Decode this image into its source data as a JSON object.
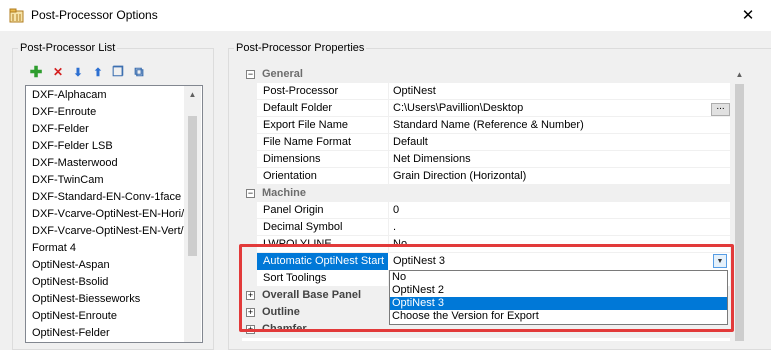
{
  "window": {
    "title": "Post-Processor Options",
    "close_glyph": "✕",
    "icon": "app-window-icon"
  },
  "left_panel": {
    "group_label": "Post-Processor List",
    "toolbar": [
      {
        "name": "add-icon",
        "glyph": "✚",
        "color": "#2e9d2e"
      },
      {
        "name": "delete-icon",
        "glyph": "✕",
        "color": "#d42020"
      },
      {
        "name": "move-down-icon",
        "glyph": "⬇",
        "color": "#2c6fd1"
      },
      {
        "name": "move-up-icon",
        "glyph": "⬆",
        "color": "#2c6fd1"
      },
      {
        "name": "copy-icon",
        "glyph": "❐",
        "color": "#3c6fb0"
      },
      {
        "name": "export-icon",
        "glyph": "⧉",
        "color": "#3c6fb0"
      }
    ],
    "items": [
      "DXF-Alphacam",
      "DXF-Enroute",
      "DXF-Felder",
      "DXF-Felder LSB",
      "DXF-Masterwood",
      "DXF-TwinCam",
      "DXF-Standard-EN-Conv-1face",
      "DXF-Vcarve-OptiNest-EN-Hori/R",
      "DXF-Vcarve-OptiNest-EN-Vert/R",
      "Format 4",
      "OptiNest-Aspan",
      "OptiNest-Bsolid",
      "OptiNest-Biesseworks",
      "OptiNest-Enroute",
      "OptiNest-Felder"
    ]
  },
  "right_panel": {
    "group_label": "Post-Processor Properties",
    "categories": {
      "general": "General",
      "machine": "Machine",
      "overall_base_panel": "Overall Base Panel",
      "outline": "Outline",
      "chamfer": "Chamfer"
    },
    "expanded_glyph": "−",
    "collapsed_glyph": "+",
    "general_props": [
      {
        "name": "Post-Processor",
        "value": "OptiNest"
      },
      {
        "name": "Default Folder",
        "value": "C:\\Users\\Pavillion\\Desktop"
      },
      {
        "name": "Export File Name",
        "value": "Standard Name (Reference & Number)"
      },
      {
        "name": "File Name Format",
        "value": "Default"
      },
      {
        "name": "Dimensions",
        "value": "Net Dimensions"
      },
      {
        "name": "Orientation",
        "value": "Grain Direction (Horizontal)"
      }
    ],
    "machine_props": [
      {
        "name": "Panel Origin",
        "value": "0"
      },
      {
        "name": "Decimal Symbol",
        "value": "."
      },
      {
        "name": "LWPOLYLINE",
        "value": "No"
      },
      {
        "name": "Automatic OptiNest Start",
        "value": "OptiNest 3"
      },
      {
        "name": "Sort Toolings",
        "value": ""
      }
    ],
    "browse_button_label": "...",
    "combo_arrow": "▼",
    "dropdown_options": [
      "No",
      "OptiNest 2",
      "OptiNest 3",
      "Choose the Version for Export"
    ],
    "dropdown_selected": "OptiNest 3"
  },
  "colors": {
    "selection": "#0078d7",
    "highlight_frame": "#e23a3a"
  }
}
